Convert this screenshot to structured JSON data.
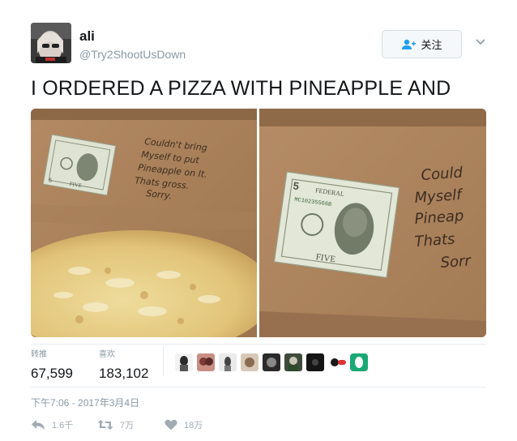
{
  "author": {
    "display_name": "ali",
    "handle": "@Try2ShootUsDown"
  },
  "follow_button": {
    "label": "关注",
    "icon": "add-user-icon"
  },
  "menu": {
    "icon": "chevron-down-icon"
  },
  "tweet": {
    "text": "I ORDERED A PIZZA WITH PINEAPPLE AND",
    "note_left_lines": [
      "Couldn't bring",
      "Myself to put",
      "Pineapple on It.",
      "Thats gross.",
      "Sorry."
    ],
    "note_right_lines": [
      "Could",
      "Myself",
      "Pineap",
      "Thats",
      "Sorr"
    ],
    "bill_left_label": "FIVE",
    "bill_right_label": "FIVE",
    "bill_right_header": "FEDERAL",
    "bill_right_serial": "MC10235566B",
    "bill_right_numeral": "5"
  },
  "stats": {
    "retweets_label": "转推",
    "retweets_value": "67,599",
    "likes_label": "喜欢",
    "likes_value": "183,102"
  },
  "likers_count_shown": 10,
  "timestamp": "下午7:06 - 2017年3月4日",
  "actions": {
    "reply_count": "1.6千",
    "retweet_count": "7万",
    "like_count": "18万"
  },
  "colors": {
    "text_primary": "#14171a",
    "text_secondary": "#8899a6",
    "action_gray": "#a0aab3",
    "border": "#e6ecf0"
  }
}
